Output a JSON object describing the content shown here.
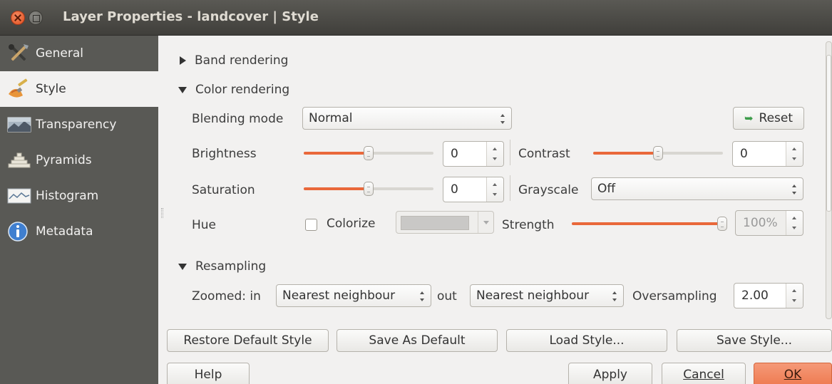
{
  "window": {
    "title": "Layer Properties - landcover | Style"
  },
  "sidebar": {
    "items": [
      {
        "label": "General",
        "icon": "tools-icon"
      },
      {
        "label": "Style",
        "icon": "paintbrush-icon"
      },
      {
        "label": "Transparency",
        "icon": "transparency-icon"
      },
      {
        "label": "Pyramids",
        "icon": "pyramids-icon"
      },
      {
        "label": "Histogram",
        "icon": "histogram-icon"
      },
      {
        "label": "Metadata",
        "icon": "info-icon"
      }
    ],
    "selected": "Style"
  },
  "band_rendering": {
    "label": "Band rendering",
    "expanded": false
  },
  "color_rendering": {
    "label": "Color rendering",
    "expanded": true,
    "blending_mode_label": "Blending mode",
    "blending_mode_value": "Normal",
    "reset_label": "Reset",
    "brightness_label": "Brightness",
    "brightness_value": "0",
    "brightness_slider_fraction": 0.5,
    "contrast_label": "Contrast",
    "contrast_value": "0",
    "contrast_slider_fraction": 0.5,
    "saturation_label": "Saturation",
    "saturation_value": "0",
    "saturation_slider_fraction": 0.5,
    "grayscale_label": "Grayscale",
    "grayscale_value": "Off",
    "hue_label": "Hue",
    "colorize_label": "Colorize",
    "colorize_checked": false,
    "colorize_color": "#c9c8c6",
    "strength_label": "Strength",
    "strength_value": "100%",
    "strength_slider_fraction": 1.0
  },
  "resampling": {
    "label": "Resampling",
    "expanded": true,
    "zoomed_in_label": "Zoomed: in",
    "zoomed_in_value": "Nearest neighbour",
    "out_label": "out",
    "zoomed_out_value": "Nearest neighbour",
    "oversampling_label": "Oversampling",
    "oversampling_value": "2.00"
  },
  "style_buttons": {
    "restore_default": "Restore Default Style",
    "save_as_default": "Save As Default",
    "load_style": "Load Style...",
    "save_style": "Save Style..."
  },
  "dialog_buttons": {
    "help": "Help",
    "apply": "Apply",
    "cancel": "Cancel",
    "ok": "OK"
  },
  "colors": {
    "accent": "#e9683a",
    "sidebar_bg": "#595955",
    "titlebar_bg": "#403f3b",
    "ok_button": "#ee7a50"
  }
}
